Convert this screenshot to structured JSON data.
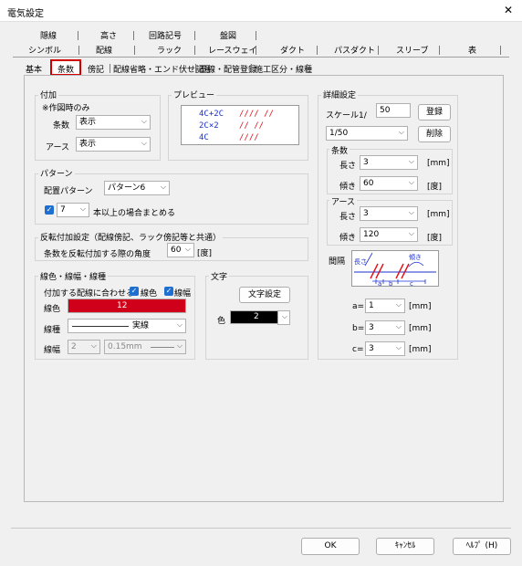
{
  "window": {
    "title": "電気設定",
    "close_glyph": "✕"
  },
  "tabs_row1": [
    "隠線",
    "高さ",
    "回路記号",
    "盤図"
  ],
  "tabs_row2": [
    "シンボル",
    "配線",
    "ラック",
    "レースウェイ",
    "ダクト",
    "パスダクト",
    "スリーブ",
    "表"
  ],
  "subtabs": [
    "基本",
    "条数",
    "傍記",
    "配線省略・エンド伏せ記号",
    "電線・配管登録",
    "施工区分・線種"
  ],
  "fuka": {
    "title": "付加",
    "note": "※作図時のみ",
    "jousu_label": "条数",
    "jousu_value": "表示",
    "earth_label": "アース",
    "earth_value": "表示"
  },
  "preview": {
    "title": "プレビュー",
    "lines": [
      {
        "text": "4C+2C",
        "marks": "//// //"
      },
      {
        "text": "2C×2",
        "marks": "// //"
      },
      {
        "text": "4C",
        "marks": "////"
      }
    ],
    "text_color": "#1a2fd0",
    "mark_color": "#e0101a"
  },
  "pattern": {
    "title": "パターン",
    "label": "配置パターン",
    "value": "パターン6",
    "group_count": "7",
    "group_label": "本以上の場合まとめる"
  },
  "hanten": {
    "title": "反転付加設定（配線傍記、ラック傍記等と共通）",
    "label": "条数を反転付加する際の角度",
    "value": "60",
    "unit": "[度]"
  },
  "linecolor": {
    "title": "線色・線幅・線種",
    "apply_label": "付加する配線に合わせる",
    "cb_color": "線色",
    "cb_width": "線幅",
    "color_label": "線色",
    "color_value": "12",
    "color_hex": "#d0001a",
    "type_label": "線種",
    "type_value": "実線",
    "width_label": "線幅",
    "width_value": "2",
    "width_mm": "0.15mm"
  },
  "moji": {
    "title": "文字",
    "button": "文字設定",
    "color_label": "色",
    "color_value": "2",
    "color_hex": "#000000"
  },
  "detail": {
    "title": "詳細設定",
    "scale_label": "スケール1/",
    "scale_value": "50",
    "register": "登録",
    "scale_select": "1/50",
    "delete": "削除",
    "jousu_title": "条数",
    "length_label": "長さ",
    "length_value": "3",
    "length_unit": "[mm]",
    "angle_label": "傾き",
    "angle_value": "60",
    "angle_unit": "[度]",
    "earth_title": "アース",
    "earth_length_value": "3",
    "earth_angle_value": "120",
    "kankaku_label": "間隔",
    "diagram": {
      "len": "長さ",
      "tilt": "傾き",
      "a": "a",
      "b": "b",
      "c": "c"
    },
    "a_label": "a=",
    "a_value": "1",
    "b_label": "b=",
    "b_value": "3",
    "c_label": "c=",
    "c_value": "3",
    "mm": "[mm]"
  },
  "footer": {
    "ok": "OK",
    "cancel": "ｷｬﾝｾﾙ",
    "help": "ﾍﾙﾌﾟ (H)"
  }
}
